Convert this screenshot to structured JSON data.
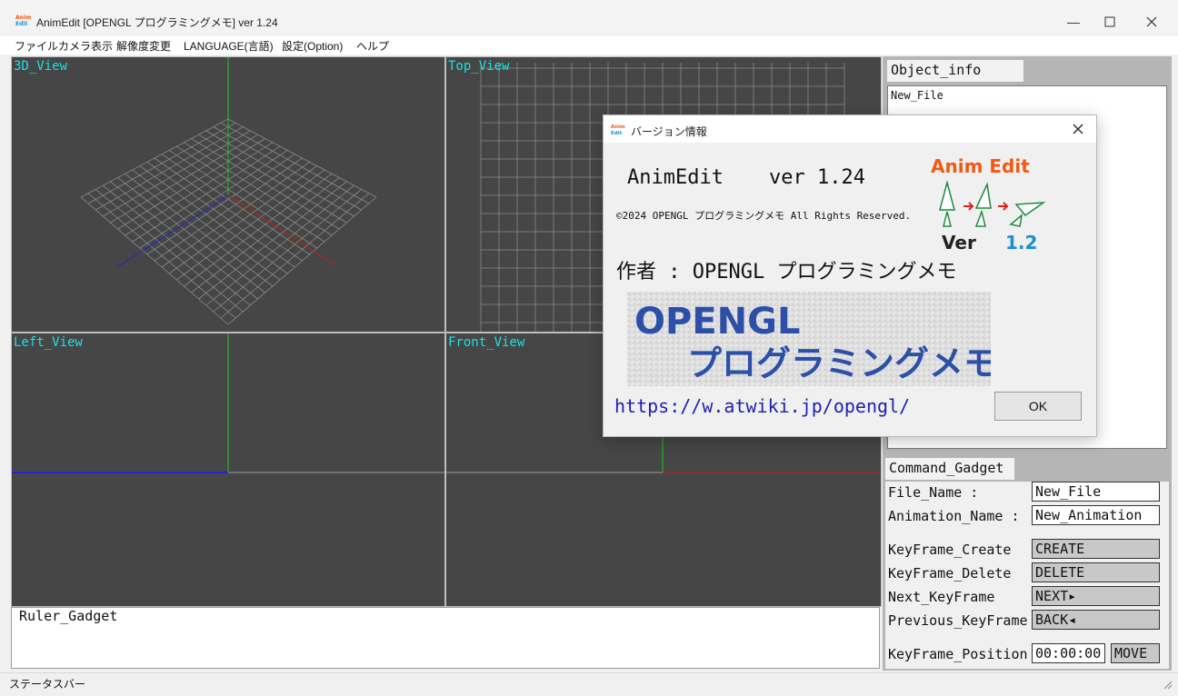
{
  "window": {
    "title": "AnimEdit [OPENGL プログラミングメモ] ver 1.24",
    "icon_text": "Anim Edit"
  },
  "menu": [
    {
      "label": "ファイル"
    },
    {
      "label": "カメラ表示"
    },
    {
      "label": "解像度変更"
    },
    {
      "label": "LANGUAGE(言語)"
    },
    {
      "label": "設定(Option)"
    },
    {
      "label": "ヘルプ"
    }
  ],
  "views": {
    "view3d": "3D_View",
    "top": "Top_View",
    "left": "Left_View",
    "front": "Front_View"
  },
  "ruler": {
    "label": "Ruler_Gadget"
  },
  "object_info": {
    "label": "Object_info",
    "items": [
      "New_File"
    ]
  },
  "command": {
    "label": "Command_Gadget",
    "file_name_label": "File_Name :",
    "file_name_value": "New_File",
    "anim_name_label": "Animation_Name  :",
    "anim_name_value": "New_Animation",
    "kf_create_label": "KeyFrame_Create",
    "kf_create_btn": "CREATE",
    "kf_delete_label": "KeyFrame_Delete",
    "kf_delete_btn": "DELETE",
    "next_label": "Next_KeyFrame",
    "next_btn": "NEXT▸",
    "prev_label": "Previous_KeyFrame",
    "prev_btn": "BACK◂",
    "pos_label": "KeyFrame_Position",
    "pos_value": "00:00:00",
    "move_btn": "MOVE"
  },
  "status": {
    "text": "ステータスバー"
  },
  "dialog": {
    "title": "バージョン情報",
    "app_name": "AnimEdit",
    "version": "ver 1.24",
    "copyright": "©2024 OPENGL プログラミングメモ All Rights Reserved.",
    "author": "作者 : OPENGL プログラミングメモ",
    "banner_line1": "OPENGL",
    "banner_line2": "プログラミングメモ",
    "url": "https://w.atwiki.jp/opengl/",
    "ok_label": "OK",
    "logo_title": "Anim Edit",
    "logo_ver": "Ver",
    "logo_num": "1.2"
  },
  "colors": {
    "viewport_bg": "#464646",
    "view_label": "#1ae0e8",
    "axis_x": "#c81e1e",
    "axis_y": "#1ec81e",
    "axis_z": "#1e1ec8",
    "link": "#1e1eb4",
    "logo_orange": "#f05a12",
    "logo_blue": "#1a8fd8"
  }
}
